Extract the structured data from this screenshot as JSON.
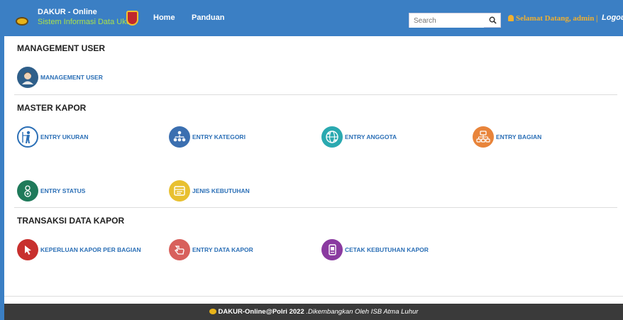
{
  "header": {
    "brand_title": "DAKUR - Online",
    "brand_subtitle": "Sistem Informasi Data Ukur",
    "nav": [
      "Home",
      "Panduan"
    ],
    "search_placeholder": "Search",
    "welcome": "Selamat Datang, admin |",
    "logout": "Logout",
    "accent_color": "#3b7fc4"
  },
  "sections": [
    {
      "title": "MANAGEMENT USER",
      "items": [
        {
          "label": "MANAGEMENT USER",
          "icon": "user-avatar-icon",
          "color": "#2f5f8a"
        }
      ]
    },
    {
      "title": "MASTER KAPOR",
      "items": [
        {
          "label": "ENTRY UKURAN",
          "icon": "measure-person-icon",
          "color": "#ffffff"
        },
        {
          "label": "ENTRY KATEGORI",
          "icon": "hierarchy-icon",
          "color": "#3b6fb0"
        },
        {
          "label": "ENTRY ANGGOTA",
          "icon": "globe-people-icon",
          "color": "#2aa9b0"
        },
        {
          "label": "ENTRY BAGIAN",
          "icon": "network-icon",
          "color": "#e8843a"
        },
        {
          "label": "ENTRY STATUS",
          "icon": "status-person-icon",
          "color": "#1f7a5a"
        },
        {
          "label": "JENIS KEBUTUHAN",
          "icon": "list-window-icon",
          "color": "#e8c030"
        }
      ]
    },
    {
      "title": "TRANSAKSI DATA KAPOR",
      "items": [
        {
          "label": "KEPERLUAN KAPOR PER BAGIAN",
          "icon": "cursor-click-icon",
          "color": "#c8302e"
        },
        {
          "label": "ENTRY DATA KAPOR",
          "icon": "hand-pointer-icon",
          "color": "#d8605c"
        },
        {
          "label": "CETAK KEBUTUHAN KAPOR",
          "icon": "mobile-doc-icon",
          "color": "#8a3aa0"
        }
      ]
    }
  ],
  "footer": {
    "brand": "DAKUR-Online@Polri 2022",
    "credit": ".Dikembangkan Oleh ISB Atma Luhur"
  }
}
